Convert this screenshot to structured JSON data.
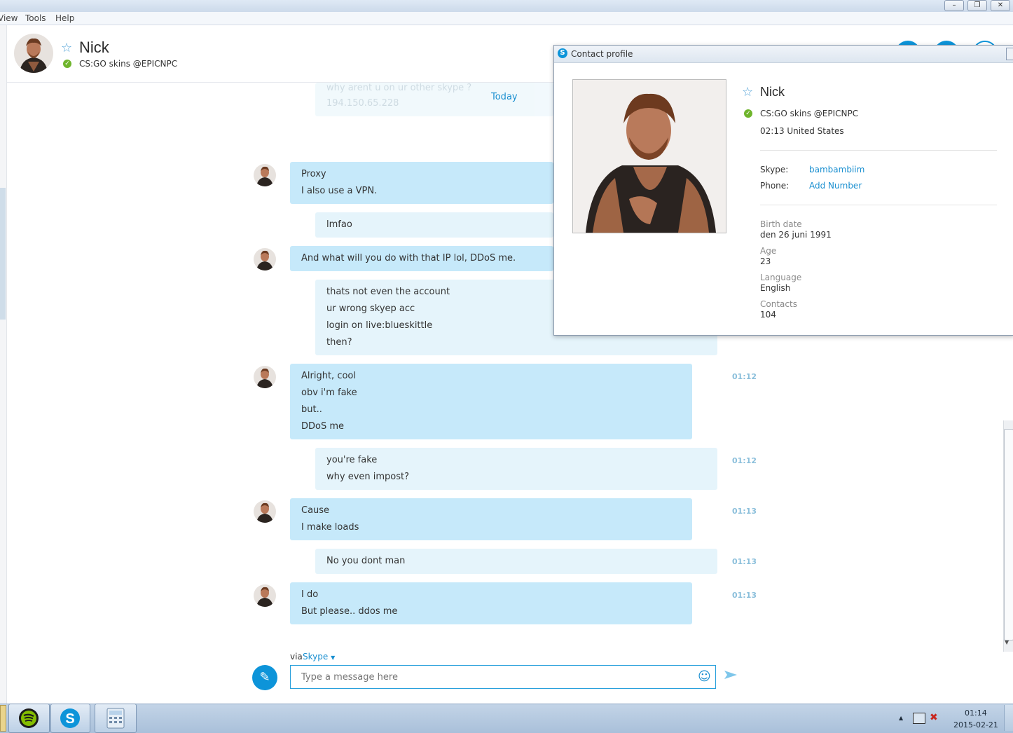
{
  "menu": {
    "items": [
      "View",
      "Tools",
      "Help"
    ]
  },
  "window_controls": {
    "minimize": "–",
    "maximize": "❐",
    "close": "✕"
  },
  "contact": {
    "name": "Nick",
    "mood": "CS:GO skins @EPICNPC",
    "status_icon": "online-check-icon"
  },
  "chat": {
    "date_separator": "Today",
    "faded_lines": [
      "why arent u on ur other skype ?",
      "194.150.65.228"
    ],
    "messages": [
      {
        "dir": "in",
        "lines": [
          "Proxy",
          "I also use a VPN."
        ],
        "time": ""
      },
      {
        "dir": "out",
        "lines": [
          "lmfao"
        ],
        "time": ""
      },
      {
        "dir": "in",
        "lines": [
          "And what will you do with that IP lol, DDoS me."
        ],
        "time": ""
      },
      {
        "dir": "out",
        "lines": [
          "thats not even the account",
          "ur wrong skyep acc",
          "login on live:blueskittle",
          "then?"
        ],
        "time": ""
      },
      {
        "dir": "in",
        "lines": [
          "Alright, cool",
          "obv i'm fake",
          "but..",
          "DDoS me"
        ],
        "time": "01:12"
      },
      {
        "dir": "out",
        "lines": [
          "you're fake",
          "why even impost?"
        ],
        "time": "01:12"
      },
      {
        "dir": "in",
        "lines": [
          "Cause",
          "I make loads"
        ],
        "time": "01:13"
      },
      {
        "dir": "out",
        "lines": [
          "No you dont man"
        ],
        "time": "01:13"
      },
      {
        "dir": "in",
        "lines": [
          "I do",
          "But please.. ddos me"
        ],
        "time": "01:13"
      }
    ]
  },
  "composer": {
    "via_label": "via",
    "via_service": "Skype",
    "placeholder": "Type a message here"
  },
  "profile": {
    "window_title": "Contact profile",
    "name": "Nick",
    "mood": "CS:GO skins @EPICNPC",
    "local_time_location": "02:13 United States",
    "skype_label": "Skype:",
    "skype_value": "bambambiim",
    "phone_label": "Phone:",
    "phone_value": "Add Number",
    "birth_label": "Birth date",
    "birth_value": "den 26 juni 1991",
    "age_label": "Age",
    "age_value": "23",
    "language_label": "Language",
    "language_value": "English",
    "contacts_label": "Contacts",
    "contacts_value": "104"
  },
  "taskbar": {
    "apps": [
      "spotify-icon",
      "skype-icon",
      "calculator-icon"
    ],
    "clock_time": "01:14",
    "clock_date": "2015-02-21"
  },
  "colors": {
    "accent": "#0d94d9",
    "incoming_bubble": "#c6e9fa",
    "outgoing_bubble": "#e5f4fb",
    "online": "#6fb52c"
  }
}
